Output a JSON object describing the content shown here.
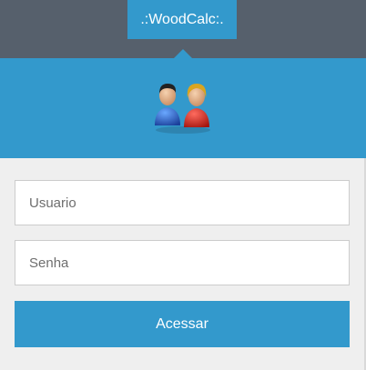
{
  "header": {
    "title": ".:WoodCalc:.",
    "icon": "users-icon"
  },
  "form": {
    "username_placeholder": "Usuario",
    "username_value": "",
    "password_placeholder": "Senha",
    "password_value": "",
    "submit_label": "Acessar"
  },
  "colors": {
    "accent": "#3399cc",
    "topbar": "#56606c",
    "form_bg": "#efefef"
  }
}
